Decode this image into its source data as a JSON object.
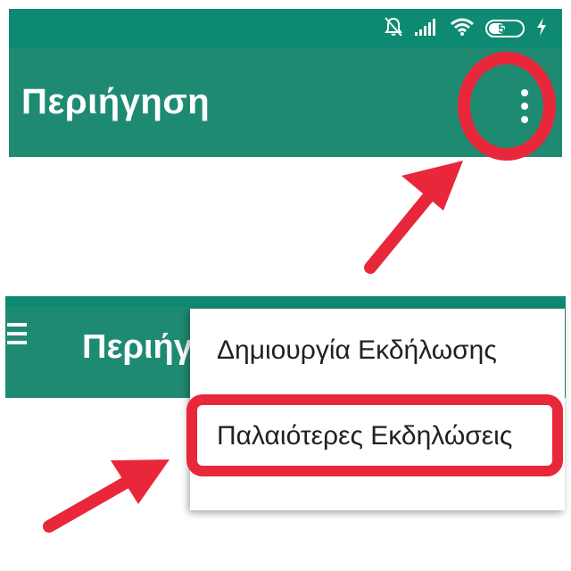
{
  "status_bar": {
    "battery_level": "51",
    "icons": [
      "bell-off-icon",
      "signal-icon",
      "wifi-icon",
      "battery-icon",
      "charging-icon"
    ]
  },
  "top_screen": {
    "title": "Περιήγηση",
    "overflow_icon": "more-vert-icon"
  },
  "bottom_screen": {
    "title": "Περιήγ",
    "menu_icon": "hamburger-icon",
    "menu": {
      "items": [
        {
          "label": "Δημιουργία Εκδήλωσης"
        },
        {
          "label": "Παλαιότερες Εκδηλώσεις"
        }
      ]
    }
  },
  "colors": {
    "app_bar": "#1f8a72",
    "status_bar": "#0f8a72",
    "annotation": "#e8273a",
    "menu_bg": "#ffffff",
    "menu_text": "#202124"
  }
}
